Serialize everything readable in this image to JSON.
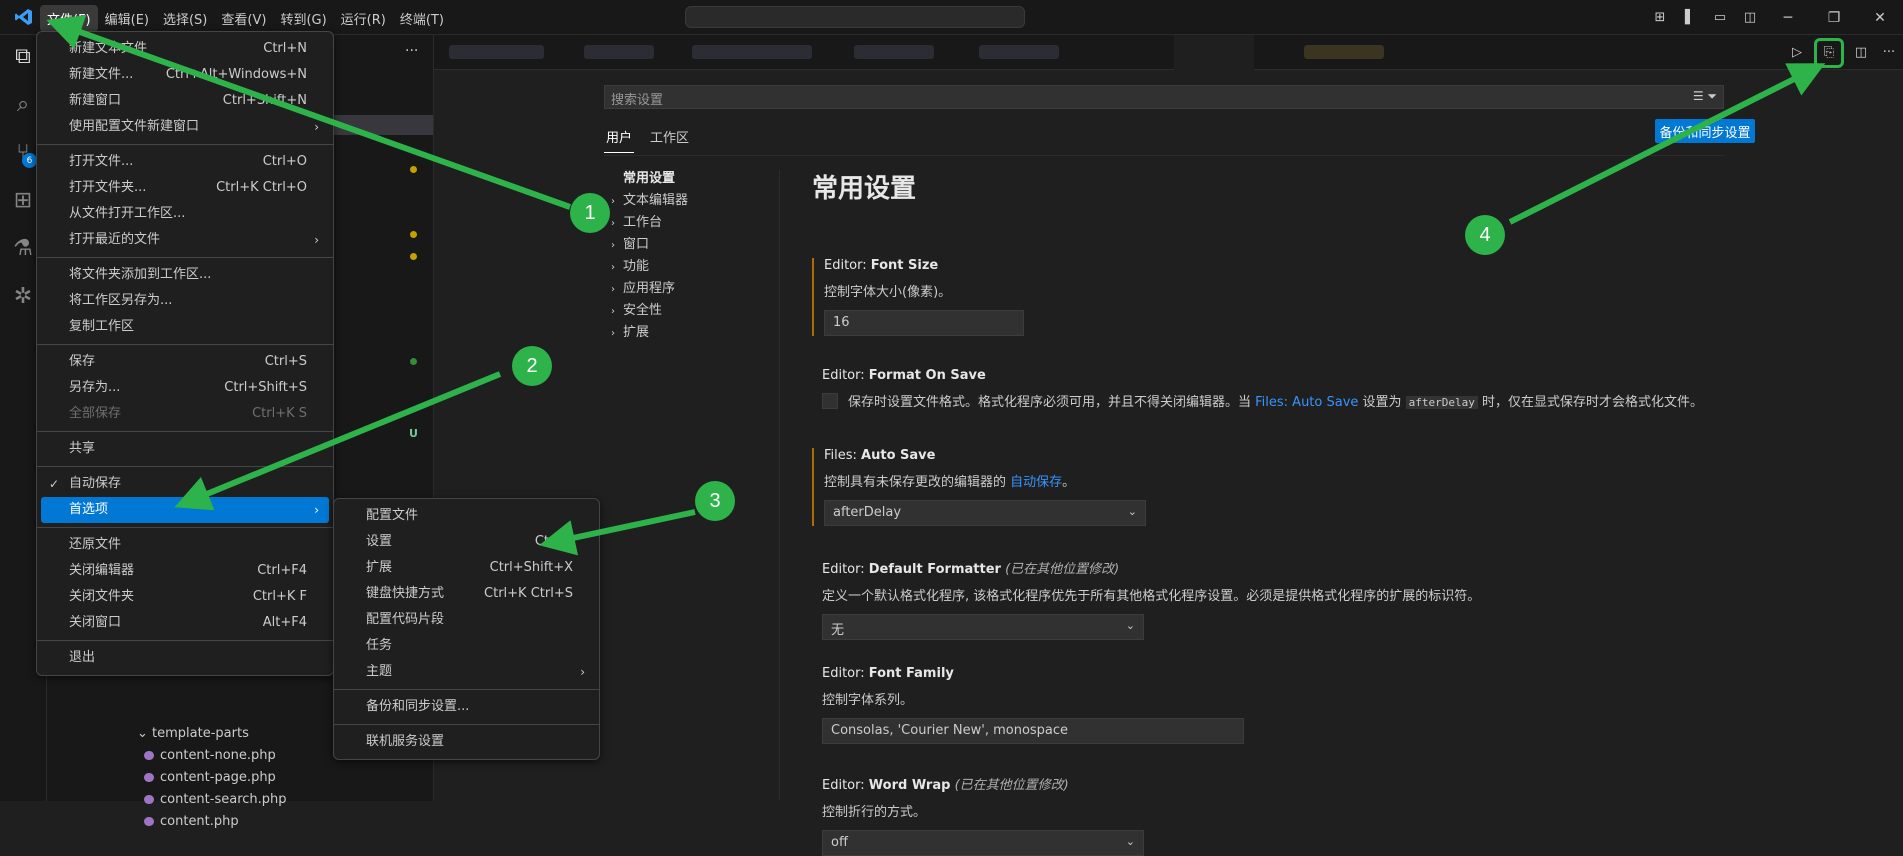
{
  "menubar": [
    "文件(F)",
    "编辑(E)",
    "选择(S)",
    "查看(V)",
    "转到(G)",
    "运行(R)",
    "终端(T)"
  ],
  "file_menu": {
    "groups": [
      [
        {
          "label": "新建文本文件",
          "key": "Ctrl+N"
        },
        {
          "label": "新建文件...",
          "key": "Ctrl+Alt+Windows+N"
        },
        {
          "label": "新建窗口",
          "key": "Ctrl+Shift+N"
        },
        {
          "label": "使用配置文件新建窗口",
          "submenu": true
        }
      ],
      [
        {
          "label": "打开文件...",
          "key": "Ctrl+O"
        },
        {
          "label": "打开文件夹...",
          "key": "Ctrl+K Ctrl+O"
        },
        {
          "label": "从文件打开工作区..."
        },
        {
          "label": "打开最近的文件",
          "submenu": true
        }
      ],
      [
        {
          "label": "将文件夹添加到工作区..."
        },
        {
          "label": "将工作区另存为..."
        },
        {
          "label": "复制工作区"
        }
      ],
      [
        {
          "label": "保存",
          "key": "Ctrl+S"
        },
        {
          "label": "另存为...",
          "key": "Ctrl+Shift+S"
        },
        {
          "label": "全部保存",
          "key": "Ctrl+K S",
          "disabled": true
        }
      ],
      [
        {
          "label": "共享",
          "submenu": true
        }
      ],
      [
        {
          "label": "自动保存",
          "checked": true
        },
        {
          "label": "首选项",
          "submenu": true,
          "selected": true
        }
      ],
      [
        {
          "label": "还原文件"
        },
        {
          "label": "关闭编辑器",
          "key": "Ctrl+F4"
        },
        {
          "label": "关闭文件夹",
          "key": "Ctrl+K F"
        },
        {
          "label": "关闭窗口",
          "key": "Alt+F4"
        }
      ],
      [
        {
          "label": "退出"
        }
      ]
    ]
  },
  "prefs_menu": {
    "groups": [
      [
        {
          "label": "配置文件"
        },
        {
          "label": "设置",
          "key": "Ctrl+,"
        },
        {
          "label": "扩展",
          "key": "Ctrl+Shift+X"
        },
        {
          "label": "键盘快捷方式",
          "key": "Ctrl+K Ctrl+S"
        },
        {
          "label": "配置代码片段"
        },
        {
          "label": "任务"
        },
        {
          "label": "主题",
          "submenu": true
        }
      ],
      [
        {
          "label": "备份和同步设置..."
        }
      ],
      [
        {
          "label": "联机服务设置"
        }
      ]
    ]
  },
  "explorer": {
    "badge": "6",
    "folder": "template-parts",
    "files": [
      "content-none.php",
      "content-page.php",
      "content-search.php",
      "content.php"
    ],
    "u_mark": "U"
  },
  "settings": {
    "search_placeholder": "搜索设置",
    "tabs": [
      "用户",
      "工作区"
    ],
    "sync_button": "备份和同步设置",
    "toc": [
      "常用设置",
      "文本编辑器",
      "工作台",
      "窗口",
      "功能",
      "应用程序",
      "安全性",
      "扩展"
    ],
    "title": "常用设置",
    "font_size": {
      "prefix": "Editor: ",
      "name": "Font Size",
      "desc": "控制字体大小(像素)。",
      "value": "16"
    },
    "format_on_save": {
      "prefix": "Editor: ",
      "name": "Format On Save",
      "desc_1": "保存时设置文件格式。格式化程序必须可用，并且不得关闭编辑器。当 ",
      "link": "Files: Auto Save",
      "desc_2": " 设置为 ",
      "code": "afterDelay",
      "desc_3": " 时，仅在显式保存时才会格式化文件。"
    },
    "auto_save": {
      "prefix": "Files: ",
      "name": "Auto Save",
      "desc_1": "控制具有未保存更改的编辑器的 ",
      "link": "自动保存",
      "desc_2": "。",
      "value": "afterDelay"
    },
    "default_formatter": {
      "prefix": "Editor: ",
      "name": "Default Formatter",
      "tag": "(已在其他位置修改)",
      "desc": "定义一个默认格式化程序, 该格式化程序优先于所有其他格式化程序设置。必须是提供格式化程序的扩展的标识符。",
      "value": "无"
    },
    "font_family": {
      "prefix": "Editor: ",
      "name": "Font Family",
      "desc": "控制字体系列。",
      "value": "Consolas, 'Courier New', monospace"
    },
    "word_wrap": {
      "prefix": "Editor: ",
      "name": "Word Wrap",
      "tag": "(已在其他位置修改)",
      "desc": "控制折行的方式。",
      "value": "off"
    }
  },
  "annotations": [
    "1",
    "2",
    "3",
    "4"
  ],
  "colors": {
    "accent": "#0078d4",
    "annotation": "#2db34a",
    "link": "#3794ff"
  }
}
